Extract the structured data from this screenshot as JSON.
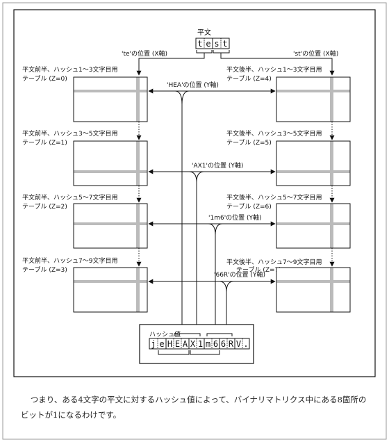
{
  "diagram": {
    "plaintext_label": "平文",
    "plaintext_chars": [
      "t",
      "e",
      "s",
      "t"
    ],
    "te_position_label": "'te'の位置 (X軸)",
    "st_position_label": "'st'の位置 (X軸)",
    "left_tables": [
      {
        "line1": "平文前半、ハッシュ1～3文字目用",
        "line2": "テーブル (Z=0)"
      },
      {
        "line1": "平文前半、ハッシュ3～5文字目用",
        "line2": "テーブル (Z=1)"
      },
      {
        "line1": "平文前半、ハッシュ5～7文字目用",
        "line2": "テーブル (Z=2)"
      },
      {
        "line1": "平文前半、ハッシュ7～9文字目用",
        "line2": "テーブル (Z=3)"
      }
    ],
    "right_tables": [
      {
        "line1": "平文後半、ハッシュ1～3文字目用",
        "line2": "テーブル (Z=4)"
      },
      {
        "line1": "平文後半、ハッシュ3～5文字目用",
        "line2": "テーブル (Z=5)"
      },
      {
        "line1": "平文後半、ハッシュ5～7文字目用",
        "line2": "テーブル (Z=6)"
      },
      {
        "line1": "平文後半、ハッシュ7～9文字目用",
        "line2": "テーブル (Z=7)"
      }
    ],
    "y_labels": [
      "'HEA'の位置 (Y軸)",
      "'AX1'の位置 (Y軸)",
      "'1m6'の位置 (Y軸)",
      "'66R'の位置 (Y軸)"
    ],
    "hash_label": "ハッシュ値",
    "hash_chars": [
      "j",
      "e",
      "H",
      "E",
      "A",
      "X",
      "1",
      "m",
      "6",
      "6",
      "R",
      "V",
      "."
    ]
  },
  "caption": "つまり、ある4文字の平文に対するハッシュ値によって、バイナリマトリクス中にある8箇所のビットが1になるわけです。"
}
